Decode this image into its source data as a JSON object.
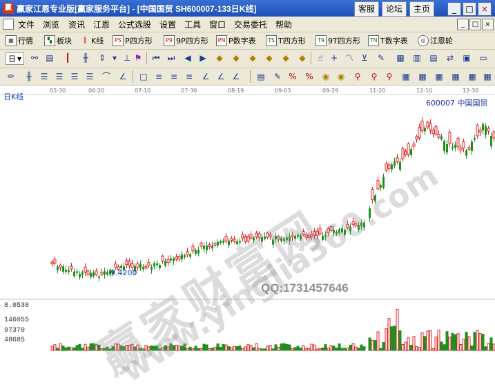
{
  "window": {
    "app_icon": "赢",
    "title": "赢家江恩专业版[赢家服务平台] - [中国国贸   SH600007-133日K线]",
    "buttons": [
      "客服",
      "论坛",
      "主页"
    ],
    "controls": [
      "_",
      "□",
      "×"
    ]
  },
  "menubar": {
    "items": [
      "文件",
      "浏览",
      "资讯",
      "江恩",
      "公式选股",
      "设置",
      "工具",
      "窗口",
      "交易委托",
      "帮助"
    ],
    "mdi_controls": [
      "_",
      "□",
      "×"
    ]
  },
  "toolbar1": {
    "items": [
      "行情",
      "板块",
      "K线",
      "P四方形",
      "9P四方形",
      "P数字表",
      "T四方形",
      "9T四方形",
      "T数字表",
      "江恩轮"
    ],
    "icon_labels": [
      "PS",
      "P9",
      "PN",
      "TS",
      "T9",
      "TN"
    ]
  },
  "toolbar2": {
    "period": "日"
  },
  "chart": {
    "panel_label": "日K线",
    "stock_code": "600007",
    "stock_name": "中国国贸",
    "low_marker": "9.4200",
    "watermark_cn": "赢家财富网",
    "watermark_url": "www.yingjia360.com",
    "qq_text": "QQ:1731457646",
    "dates": [
      "05-30",
      "06-20",
      "07-10",
      "07-30",
      "08-19",
      "09-03",
      "09-29",
      "11-20",
      "12-10",
      "12-30"
    ],
    "volume_labels": [
      "8.0538",
      "146055",
      "97370",
      "48685"
    ],
    "colors": {
      "up": "#e02020",
      "down": "#1f8f1f",
      "label_blue": "#1040c0"
    }
  }
}
